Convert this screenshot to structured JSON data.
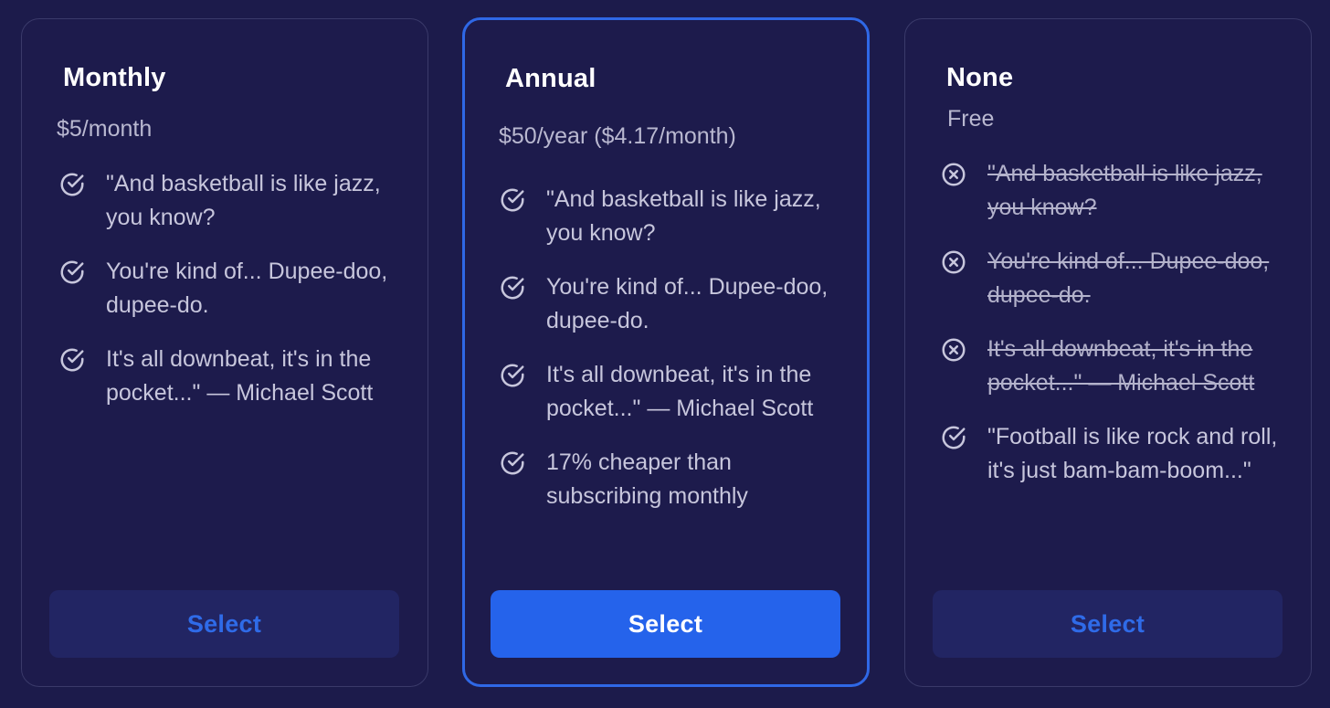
{
  "plans": [
    {
      "title": "Monthly",
      "price": "$5/month",
      "button_label": "Select",
      "features": [
        {
          "icon": "check-circle-icon",
          "text": "\"And basketball is like jazz, you know?",
          "included": true
        },
        {
          "icon": "check-circle-icon",
          "text": "You're kind of... Dupee-doo, dupee-do.",
          "included": true
        },
        {
          "icon": "check-circle-icon",
          "text": "It's all downbeat, it's in the pocket...\" — Michael Scott",
          "included": true
        }
      ]
    },
    {
      "title": "Annual",
      "price": "$50/year ($4.17/month)",
      "button_label": "Select",
      "features": [
        {
          "icon": "check-circle-icon",
          "text": "\"And basketball is like jazz, you know?",
          "included": true
        },
        {
          "icon": "check-circle-icon",
          "text": "You're kind of... Dupee-doo, dupee-do.",
          "included": true
        },
        {
          "icon": "check-circle-icon",
          "text": "It's all downbeat, it's in the pocket...\" — Michael Scott",
          "included": true
        },
        {
          "icon": "check-circle-icon",
          "text": "17% cheaper than subscribing monthly",
          "included": true
        }
      ]
    },
    {
      "title": "None",
      "price": "Free",
      "button_label": "Select",
      "features": [
        {
          "icon": "x-circle-icon",
          "text": "\"And basketball is like jazz, you know?",
          "included": false
        },
        {
          "icon": "x-circle-icon",
          "text": "You're kind of... Dupee-doo, dupee-do.",
          "included": false
        },
        {
          "icon": "x-circle-icon",
          "text": "It's all downbeat, it's in the pocket...\" — Michael Scott",
          "included": false
        },
        {
          "icon": "check-circle-icon",
          "text": "\"Football is like rock and roll, it's just bam-bam-boom...\"",
          "included": true
        }
      ]
    }
  ],
  "colors": {
    "background": "#1c1b4b",
    "accent": "#2563eb",
    "card_border": "#3a3a6a",
    "secondary_button_bg": "#222563"
  }
}
